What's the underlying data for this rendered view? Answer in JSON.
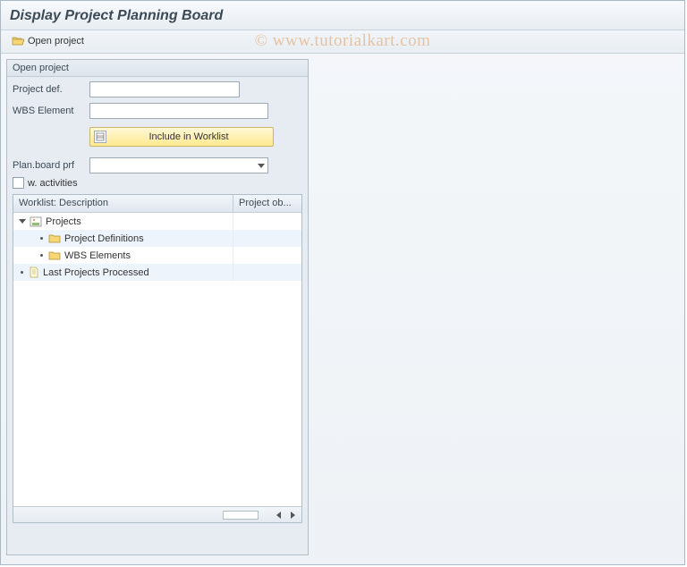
{
  "title": "Display Project Planning Board",
  "toolbar": {
    "open_project": "Open project"
  },
  "panel": {
    "title": "Open project",
    "labels": {
      "project_def": "Project def.",
      "wbs_element": "WBS Element",
      "plan_board_prf": "Plan.board prf",
      "w_activities": "w. activities"
    },
    "values": {
      "project_def": "",
      "wbs_element": "",
      "plan_board_prf": "",
      "w_activities_checked": false
    },
    "include_worklist_btn": "Include in Worklist"
  },
  "tree": {
    "columns": {
      "col1": "Worklist: Description",
      "col2": "Project ob..."
    },
    "nodes": {
      "projects": "Projects",
      "project_definitions": "Project Definitions",
      "wbs_elements": "WBS Elements",
      "last_projects": "Last Projects Processed"
    }
  },
  "watermark": "© www.tutorialkart.com"
}
